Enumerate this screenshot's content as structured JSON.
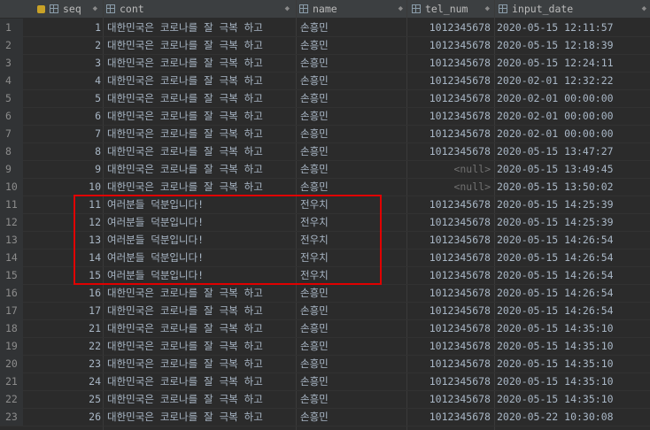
{
  "columns": {
    "seq": "seq",
    "cont": "cont",
    "name": "name",
    "tel_num": "tel_num",
    "input_date": "input_date"
  },
  "rows": [
    {
      "rn": "1",
      "seq": "1",
      "cont": "대한민국은 코로나를 잘 극복 하고",
      "name": "손흥민",
      "tel_num": "1012345678",
      "input_date": "2020-05-15 12:11:57"
    },
    {
      "rn": "2",
      "seq": "2",
      "cont": "대한민국은 코로나를 잘 극복 하고",
      "name": "손흥민",
      "tel_num": "1012345678",
      "input_date": "2020-05-15 12:18:39"
    },
    {
      "rn": "3",
      "seq": "3",
      "cont": "대한민국은 코로나를 잘 극복 하고",
      "name": "손흥민",
      "tel_num": "1012345678",
      "input_date": "2020-05-15 12:24:11"
    },
    {
      "rn": "4",
      "seq": "4",
      "cont": "대한민국은 코로나를 잘 극복 하고",
      "name": "손흥민",
      "tel_num": "1012345678",
      "input_date": "2020-02-01 12:32:22"
    },
    {
      "rn": "5",
      "seq": "5",
      "cont": "대한민국은 코로나를 잘 극복 하고",
      "name": "손흥민",
      "tel_num": "1012345678",
      "input_date": "2020-02-01 00:00:00"
    },
    {
      "rn": "6",
      "seq": "6",
      "cont": "대한민국은 코로나를 잘 극복 하고",
      "name": "손흥민",
      "tel_num": "1012345678",
      "input_date": "2020-02-01 00:00:00"
    },
    {
      "rn": "7",
      "seq": "7",
      "cont": "대한민국은 코로나를 잘 극복 하고",
      "name": "손흥민",
      "tel_num": "1012345678",
      "input_date": "2020-02-01 00:00:00"
    },
    {
      "rn": "8",
      "seq": "8",
      "cont": "대한민국은 코로나를 잘 극복 하고",
      "name": "손흥민",
      "tel_num": "1012345678",
      "input_date": "2020-05-15 13:47:27"
    },
    {
      "rn": "9",
      "seq": "9",
      "cont": "대한민국은 코로나를 잘 극복 하고",
      "name": "손흥민",
      "tel_num": "<null>",
      "input_date": "2020-05-15 13:49:45"
    },
    {
      "rn": "10",
      "seq": "10",
      "cont": "대한민국은 코로나를 잘 극복 하고",
      "name": "손흥민",
      "tel_num": "<null>",
      "input_date": "2020-05-15 13:50:02"
    },
    {
      "rn": "11",
      "seq": "11",
      "cont": "여러분들 덕분입니다!",
      "name": "전우치",
      "tel_num": "1012345678",
      "input_date": "2020-05-15 14:25:39"
    },
    {
      "rn": "12",
      "seq": "12",
      "cont": "여러분들 덕분입니다!",
      "name": "전우치",
      "tel_num": "1012345678",
      "input_date": "2020-05-15 14:25:39"
    },
    {
      "rn": "13",
      "seq": "13",
      "cont": "여러분들 덕분입니다!",
      "name": "전우치",
      "tel_num": "1012345678",
      "input_date": "2020-05-15 14:26:54"
    },
    {
      "rn": "14",
      "seq": "14",
      "cont": "여러분들 덕분입니다!",
      "name": "전우치",
      "tel_num": "1012345678",
      "input_date": "2020-05-15 14:26:54"
    },
    {
      "rn": "15",
      "seq": "15",
      "cont": "여러분들 덕분입니다!",
      "name": "전우치",
      "tel_num": "1012345678",
      "input_date": "2020-05-15 14:26:54"
    },
    {
      "rn": "16",
      "seq": "16",
      "cont": "대한민국은 코로나를 잘 극복 하고",
      "name": "손흥민",
      "tel_num": "1012345678",
      "input_date": "2020-05-15 14:26:54"
    },
    {
      "rn": "17",
      "seq": "17",
      "cont": "대한민국은 코로나를 잘 극복 하고",
      "name": "손흥민",
      "tel_num": "1012345678",
      "input_date": "2020-05-15 14:26:54"
    },
    {
      "rn": "18",
      "seq": "21",
      "cont": "대한민국은 코로나를 잘 극복 하고",
      "name": "손흥민",
      "tel_num": "1012345678",
      "input_date": "2020-05-15 14:35:10"
    },
    {
      "rn": "19",
      "seq": "22",
      "cont": "대한민국은 코로나를 잘 극복 하고",
      "name": "손흥민",
      "tel_num": "1012345678",
      "input_date": "2020-05-15 14:35:10"
    },
    {
      "rn": "20",
      "seq": "23",
      "cont": "대한민국은 코로나를 잘 극복 하고",
      "name": "손흥민",
      "tel_num": "1012345678",
      "input_date": "2020-05-15 14:35:10"
    },
    {
      "rn": "21",
      "seq": "24",
      "cont": "대한민국은 코로나를 잘 극복 하고",
      "name": "손흥민",
      "tel_num": "1012345678",
      "input_date": "2020-05-15 14:35:10"
    },
    {
      "rn": "22",
      "seq": "25",
      "cont": "대한민국은 코로나를 잘 극복 하고",
      "name": "손흥민",
      "tel_num": "1012345678",
      "input_date": "2020-05-15 14:35:10"
    },
    {
      "rn": "23",
      "seq": "26",
      "cont": "대한민국은 코로나를 잘 극복 하고",
      "name": "손흥민",
      "tel_num": "1012345678",
      "input_date": "2020-05-22 10:30:08"
    }
  ],
  "highlight": {
    "color": "#e00000",
    "from_row": "11",
    "to_row": "15"
  }
}
